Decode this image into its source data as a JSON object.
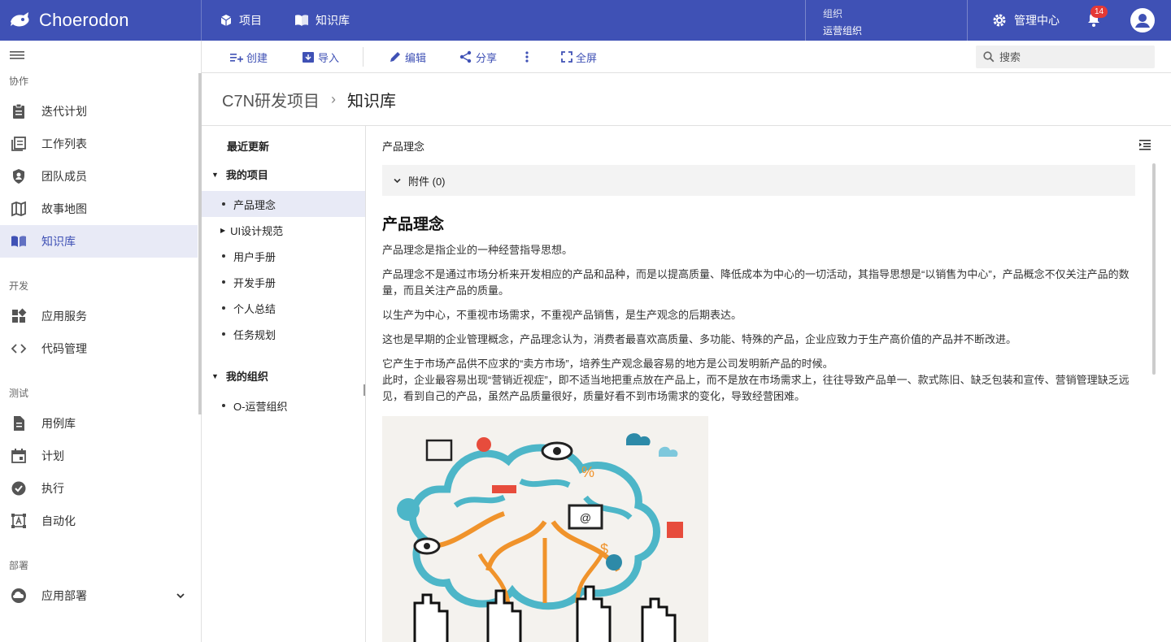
{
  "app": {
    "brand": "Choerodon"
  },
  "topnav": [
    {
      "label": "项目"
    },
    {
      "label": "知识库"
    }
  ],
  "org": {
    "label": "组织",
    "value": "运营组织"
  },
  "admin": {
    "label": "管理中心"
  },
  "notifications": {
    "count": "14"
  },
  "sidebar": {
    "sections": [
      {
        "title": "协作",
        "items": [
          {
            "label": "迭代计划"
          },
          {
            "label": "工作列表"
          },
          {
            "label": "团队成员"
          },
          {
            "label": "故事地图"
          },
          {
            "label": "知识库"
          }
        ]
      },
      {
        "title": "开发",
        "items": [
          {
            "label": "应用服务"
          },
          {
            "label": "代码管理"
          }
        ]
      },
      {
        "title": "测试",
        "items": [
          {
            "label": "用例库"
          },
          {
            "label": "计划"
          },
          {
            "label": "执行"
          },
          {
            "label": "自动化"
          }
        ]
      },
      {
        "title": "部署",
        "items": [
          {
            "label": "应用部署"
          }
        ]
      }
    ]
  },
  "toolbar": {
    "create": "创建",
    "import": "导入",
    "edit": "编辑",
    "share": "分享",
    "fullscreen": "全屏",
    "search_placeholder": "搜索"
  },
  "breadcrumb": {
    "project": "C7N研发项目",
    "current": "知识库"
  },
  "tree": {
    "recent": "最近更新",
    "my_projects": "我的项目",
    "project_items": [
      {
        "label": "产品理念"
      },
      {
        "label": "UI设计规范"
      },
      {
        "label": "用户手册"
      },
      {
        "label": "开发手册"
      },
      {
        "label": "个人总结"
      },
      {
        "label": "任务规划"
      }
    ],
    "my_orgs": "我的组织",
    "org_items": [
      {
        "label": "O-运营组织"
      }
    ]
  },
  "doc": {
    "breadcrumb_title": "产品理念",
    "attachments": "附件 (0)",
    "heading": "产品理念",
    "paragraphs": [
      "产品理念是指企业的一种经营指导思想。",
      "产品理念不是通过市场分析来开发相应的产品和品种，而是以提高质量、降低成本为中心的一切活动，其指导思想是“以销售为中心”，产品概念不仅关注产品的数量，而且关注产品的质量。",
      "以生产为中心，不重视市场需求，不重视产品销售，是生产观念的后期表达。",
      "这也是早期的企业管理概念，产品理念认为，消费者最喜欢高质量、多功能、特殊的产品，企业应致力于生产高价值的产品并不断改进。",
      "它产生于市场产品供不应求的“卖方市场”，培养生产观念最容易的地方是公司发明新产品的时候。",
      "此时，企业最容易出现“营销近视症”，即不适当地把重点放在产品上，而不是放在市场需求上，往往导致产品单一、款式陈旧、缺乏包装和宣传、营销管理缺乏远见，看到自己的产品，虽然产品质量很好，质量好看不到市场需求的变化，导致经营困难。"
    ]
  },
  "colors": {
    "primary": "#3f51b5",
    "active_bg": "#e8eaf6",
    "badge": "#e53935"
  }
}
